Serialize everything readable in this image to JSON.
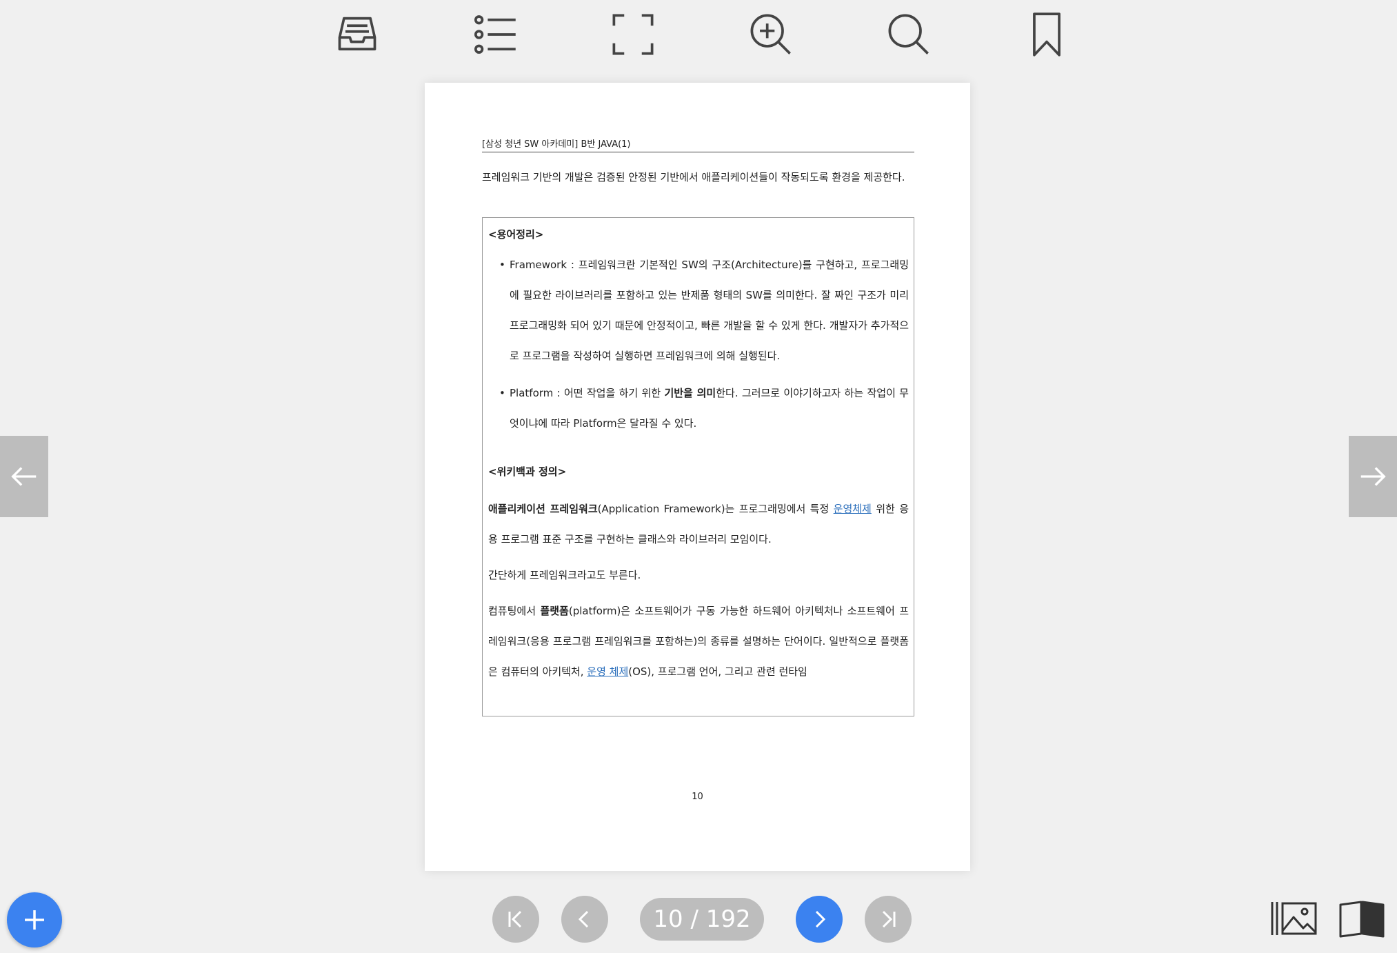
{
  "toolbar": {
    "icons": [
      "inbox-icon",
      "list-icon",
      "fullscreen-icon",
      "zoom-in-icon",
      "search-icon",
      "bookmark-icon"
    ]
  },
  "document": {
    "running_header": "[삼성 청년 SW 아카데미] B반 JAVA(1)",
    "intro": "프레임워크 기반의 개발은 검증된 안정된 기반에서 애플리케이션들이 작동되도록 환경을 제공한다.",
    "box_title": "<용어정리>",
    "terms": [
      {
        "term": "Framework",
        "text": " : 프레임워크란 기본적인 SW의 구조(Architecture)를 구현하고, 프로그래밍에 필요한 라이브러리를 포함하고 있는 반제품 형태의 SW를 의미한다. 잘 짜인 구조가 미리 프로그래밍화 되어 있기 때문에 안정적이고, 빠른 개발을 할 수 있게 한다. 개발자가 추가적으로 프로그램을 작성하여 실행하면 프레임워크에 의해 실행된다."
      },
      {
        "term": "Platform",
        "text_before": " : 어떤 작업을 하기 위한 ",
        "bold": "기반을 의미",
        "text_after": "한다. 그러므로 이야기하고자 하는 작업이 무엇이냐에 따라 Platform은 달라질 수 있다."
      }
    ],
    "wiki_title": "<위키백과 정의>",
    "wiki_p1": {
      "bold": "애플리케이션 프레임워크",
      "text_a": "(Application Framework)는 프로그래밍에서 특정 ",
      "link": "운영체제",
      "text_b": " 위한 응용 프로그램 표준 구조를 구현하는 클래스와 라이브러리 모임이다."
    },
    "wiki_p2": "간단하게 프레임워크라고도 부른다.",
    "wiki_p3": {
      "text_a": "컴퓨팅에서 ",
      "bold": "플랫폼",
      "text_b": "(platform)은 소프트웨어가 구동 가능한 하드웨어 아키텍처나 소프트웨어 프레임워크(응용 프로그램 프레임워크를 포함하는)의 종류를 설명하는 단어이다. 일반적으로 플랫폼은 컴퓨터의 아키텍처, ",
      "link": "운영 체제",
      "text_c": "(OS), 프로그램 언어, 그리고 관련 런타임"
    },
    "page_number": "10"
  },
  "pagination": {
    "current_total": "10 / 192",
    "accent_color": "#3b82f0"
  }
}
